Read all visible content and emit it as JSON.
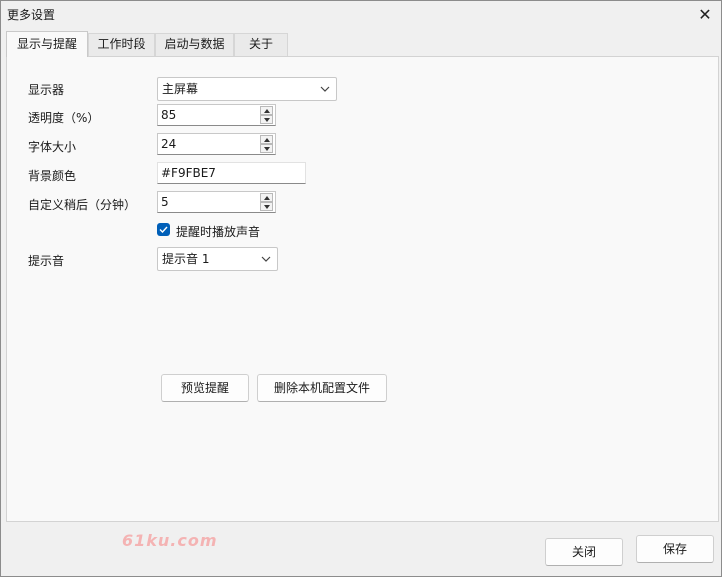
{
  "window": {
    "title": "更多设置",
    "close_glyph": "✕"
  },
  "tabs": [
    {
      "label": "显示与提醒",
      "active": true
    },
    {
      "label": "工作时段",
      "active": false
    },
    {
      "label": "启动与数据",
      "active": false
    },
    {
      "label": "关于",
      "active": false
    }
  ],
  "form": {
    "display_label": "显示器",
    "display_value": "主屏幕",
    "opacity_label": "透明度（%）",
    "opacity_value": "85",
    "font_size_label": "字体大小",
    "font_size_value": "24",
    "bg_color_label": "背景颜色",
    "bg_color_value": "#F9FBE7",
    "snooze_label": "自定义稍后（分钟）",
    "snooze_value": "5",
    "play_sound_label": "提醒时播放声音",
    "play_sound_checked": true,
    "sound_label": "提示音",
    "sound_value": "提示音 1"
  },
  "actions": {
    "preview_label": "预览提醒",
    "delete_config_label": "删除本机配置文件"
  },
  "footer": {
    "close_label": "关闭",
    "save_label": "保存"
  },
  "watermark": "61ku.com",
  "colors": {
    "accent": "#005fb8",
    "window_bg": "#f0f0f0",
    "panel_bg": "#f9f9f9",
    "watermark": "#f4b3b3"
  },
  "icons": {
    "dropdown": "chevron-down-icon",
    "spin_up": "triangle-up-icon",
    "spin_down": "triangle-down-icon",
    "check": "checkmark-icon",
    "close": "close-icon"
  }
}
